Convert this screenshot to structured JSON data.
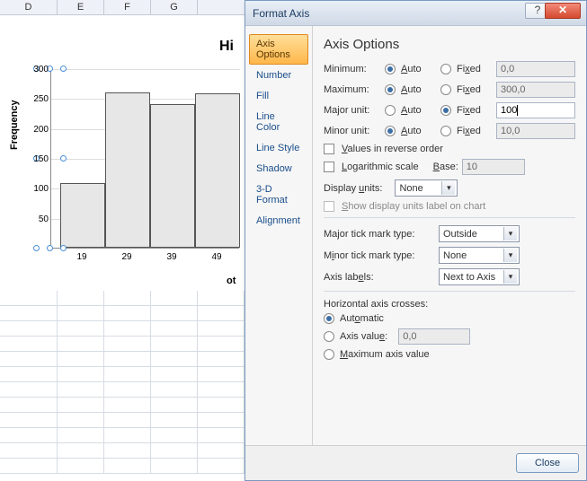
{
  "spreadsheet": {
    "columns": [
      "D",
      "E",
      "F",
      "G"
    ]
  },
  "chart_data": {
    "type": "bar",
    "title": "Hi",
    "ylabel": "Frequency",
    "xlabel": "ot",
    "categories": [
      "19",
      "29",
      "39",
      "49"
    ],
    "values": [
      108,
      260,
      240,
      258
    ],
    "ylim": [
      0,
      300
    ],
    "yticks": [
      50,
      100,
      150,
      200,
      250,
      300
    ]
  },
  "dialog": {
    "title": "Format Axis",
    "help_icon": "?",
    "close_icon": "✕",
    "close_btn": "Close",
    "sidebar": [
      {
        "label": "Axis Options",
        "active": true
      },
      {
        "label": "Number",
        "active": false
      },
      {
        "label": "Fill",
        "active": false
      },
      {
        "label": "Line Color",
        "active": false
      },
      {
        "label": "Line Style",
        "active": false
      },
      {
        "label": "Shadow",
        "active": false
      },
      {
        "label": "3-D Format",
        "active": false
      },
      {
        "label": "Alignment",
        "active": false
      }
    ],
    "panel": {
      "heading": "Axis Options",
      "rows": {
        "min": {
          "label": "Minimum:",
          "auto": "Auto",
          "fixed": "Fixed",
          "sel": "auto",
          "val": "0,0"
        },
        "max": {
          "label": "Maximum:",
          "auto": "Auto",
          "fixed": "Fixed",
          "sel": "auto",
          "val": "300,0"
        },
        "maj": {
          "label": "Major unit:",
          "auto": "Auto",
          "fixed": "Fixed",
          "sel": "fixed",
          "val": "100"
        },
        "min2": {
          "label": "Minor unit:",
          "auto": "Auto",
          "fixed": "Fixed",
          "sel": "auto",
          "val": "10,0"
        }
      },
      "values_reverse": "Values in reverse order",
      "log_scale": "Logarithmic scale",
      "log_base_lbl": "Base:",
      "log_base_val": "10",
      "display_units_lbl": "Display units:",
      "display_units_val": "None",
      "show_units_label": "Show display units label on chart",
      "major_tick_lbl": "Major tick mark type:",
      "major_tick_val": "Outside",
      "minor_tick_lbl": "Minor tick mark type:",
      "minor_tick_val": "None",
      "axis_labels_lbl": "Axis labels:",
      "axis_labels_val": "Next to Axis",
      "hax_heading": "Horizontal axis crosses:",
      "hax_auto": "Automatic",
      "hax_val_lbl": "Axis value:",
      "hax_val": "0,0",
      "hax_max": "Maximum axis value"
    }
  }
}
